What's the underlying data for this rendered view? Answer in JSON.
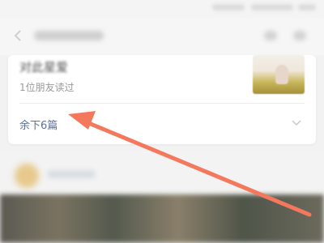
{
  "article": {
    "title": "对此星爱",
    "read_count": "1位朋友读过"
  },
  "list": {
    "more_label": "余下6篇"
  },
  "icons": {
    "back": "chevron-left-icon",
    "expand": "chevron-down-icon"
  },
  "colors": {
    "link": "#5e6f96",
    "annotation_arrow": "#f4785c"
  }
}
